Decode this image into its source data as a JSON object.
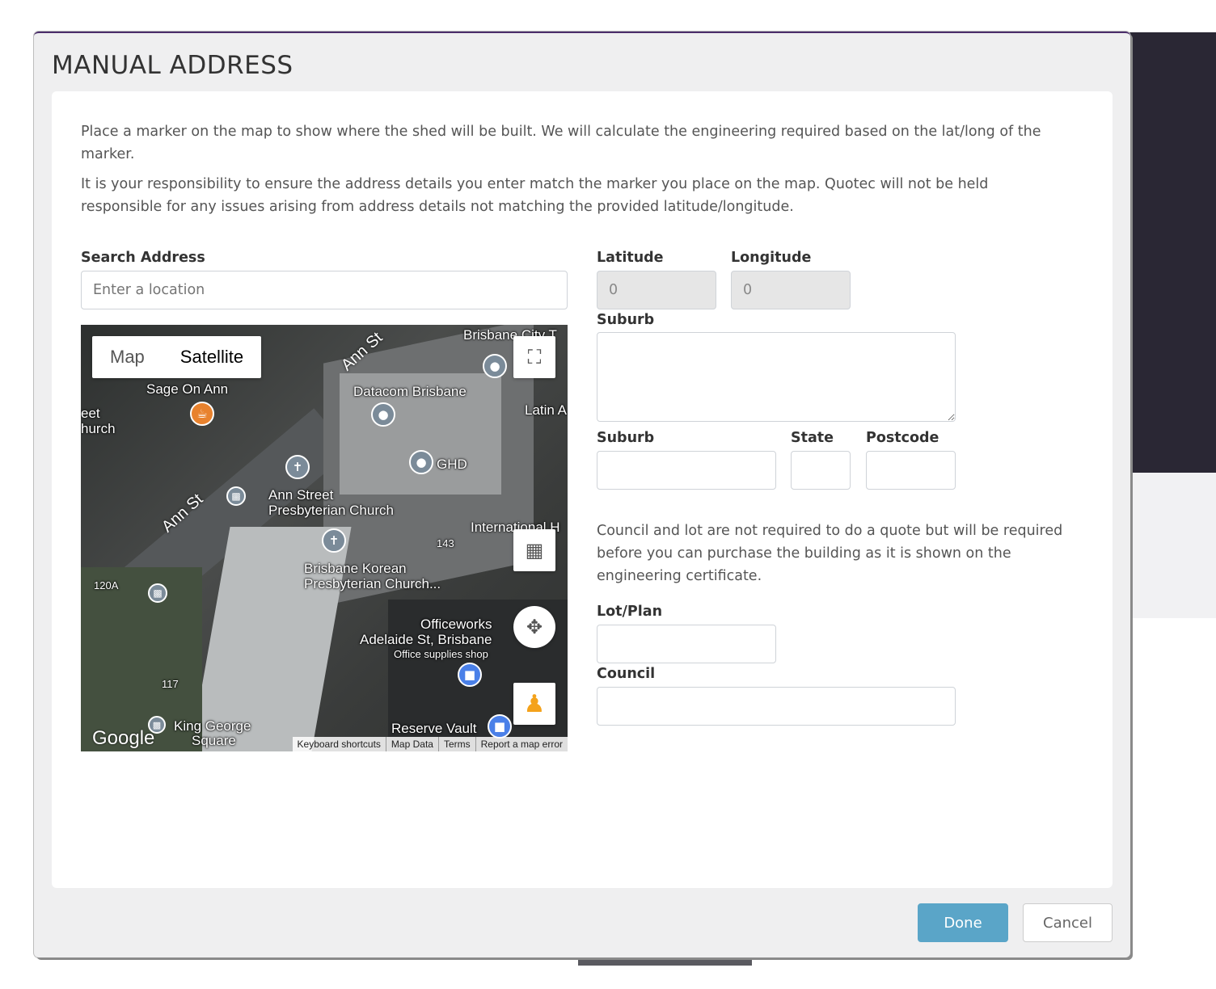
{
  "dialog": {
    "title": "MANUAL ADDRESS",
    "intro_1": "Place a marker on the map to show where the shed will be built. We will calculate the engineering required based on the lat/long of the marker.",
    "intro_2": "It is your responsibility to ensure the address details you enter match the marker you place on the map. Quotec will not be held responsible for any issues arising from address details not matching the provided latitude/longitude.",
    "note": "Council and lot are not required to do a quote but will be required before you can purchase the building as it is shown on the engineering certificate."
  },
  "form": {
    "search_label": "Search Address",
    "search_placeholder": "Enter a location",
    "latitude_label": "Latitude",
    "latitude_value": "0",
    "longitude_label": "Longitude",
    "longitude_value": "0",
    "street_label": "Suburb",
    "suburb_label": "Suburb",
    "state_label": "State",
    "postcode_label": "Postcode",
    "lot_label": "Lot/Plan",
    "council_label": "Council"
  },
  "map": {
    "type_map": "Map",
    "type_satellite": "Satellite",
    "labels": {
      "sage": "Sage On Ann",
      "datacom": "Datacom Brisbane",
      "brisbane_city": "Brisbane City T",
      "latin": "Latin A",
      "ghd": "GHD",
      "ann_church_1": "Ann Street",
      "ann_church_2": "Presbyterian Church",
      "international": "International H",
      "korean_1": "Brisbane Korean",
      "korean_2": "Presbyterian Church...",
      "num_143": "143",
      "num_120a": "120A",
      "num_117": "117",
      "officeworks_1": "Officeworks",
      "officeworks_2": "Adelaide St, Brisbane",
      "officeworks_3": "Office supplies shop",
      "king_george_1": "King George",
      "king_george_2": "Square",
      "reserve": "Reserve Vault",
      "street_church": "eet",
      "street_church2": "hurch",
      "ann_st_1": "Ann St",
      "ann_st_2": "Ann St"
    },
    "google": "Google",
    "attribution": [
      "Keyboard shortcuts",
      "Map Data",
      "Terms",
      "Report a map error"
    ]
  },
  "buttons": {
    "done": "Done",
    "cancel": "Cancel"
  },
  "colors": {
    "primary": "#5aa5c8",
    "title_bar": "#4b2d6b"
  }
}
